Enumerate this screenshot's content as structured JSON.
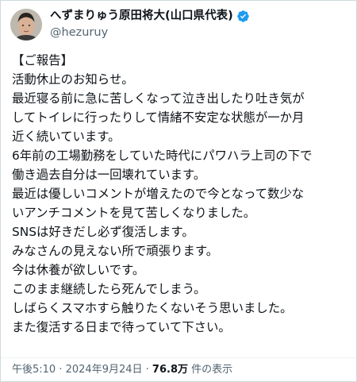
{
  "author": {
    "display_name": "へずまりゅう原田将大(山口県代表)",
    "handle": "@hezuruy",
    "verified_icon": "verified-badge-icon",
    "verified_color": "#1d9bf0"
  },
  "post": {
    "lines": [
      "【ご報告】",
      "活動休止のお知らせ。",
      "最近寝る前に急に苦しくなって泣き出したり吐き気が",
      "してトイレに行ったりして情緒不安定な状態が一か月",
      "近く続いています。",
      "6年前の工場勤務をしていた時代にパワハラ上司の下で",
      "働き過去自分は一回壊れています。",
      "最近は優しいコメントが増えたので今となって数少な",
      "いアンチコメントを見て苦しくなりました。",
      "SNSは好きだし必ず復活します。",
      "みなさんの見えない所で頑張ります。",
      "今は休養が欲しいです。",
      "このまま継続したら死んでしまう。",
      "しばらくスマホすら触りたくないそう思いました。",
      "また復活する日まで待っていて下さい。"
    ]
  },
  "meta": {
    "time": "午後5:10",
    "separator1": " · ",
    "date": "2024年9月24日",
    "separator2": " · ",
    "views_count": "76.8万",
    "views_label": " 件の表示"
  },
  "colors": {
    "text": "#0f1419",
    "secondary": "#536471",
    "border": "#cfd9de"
  }
}
